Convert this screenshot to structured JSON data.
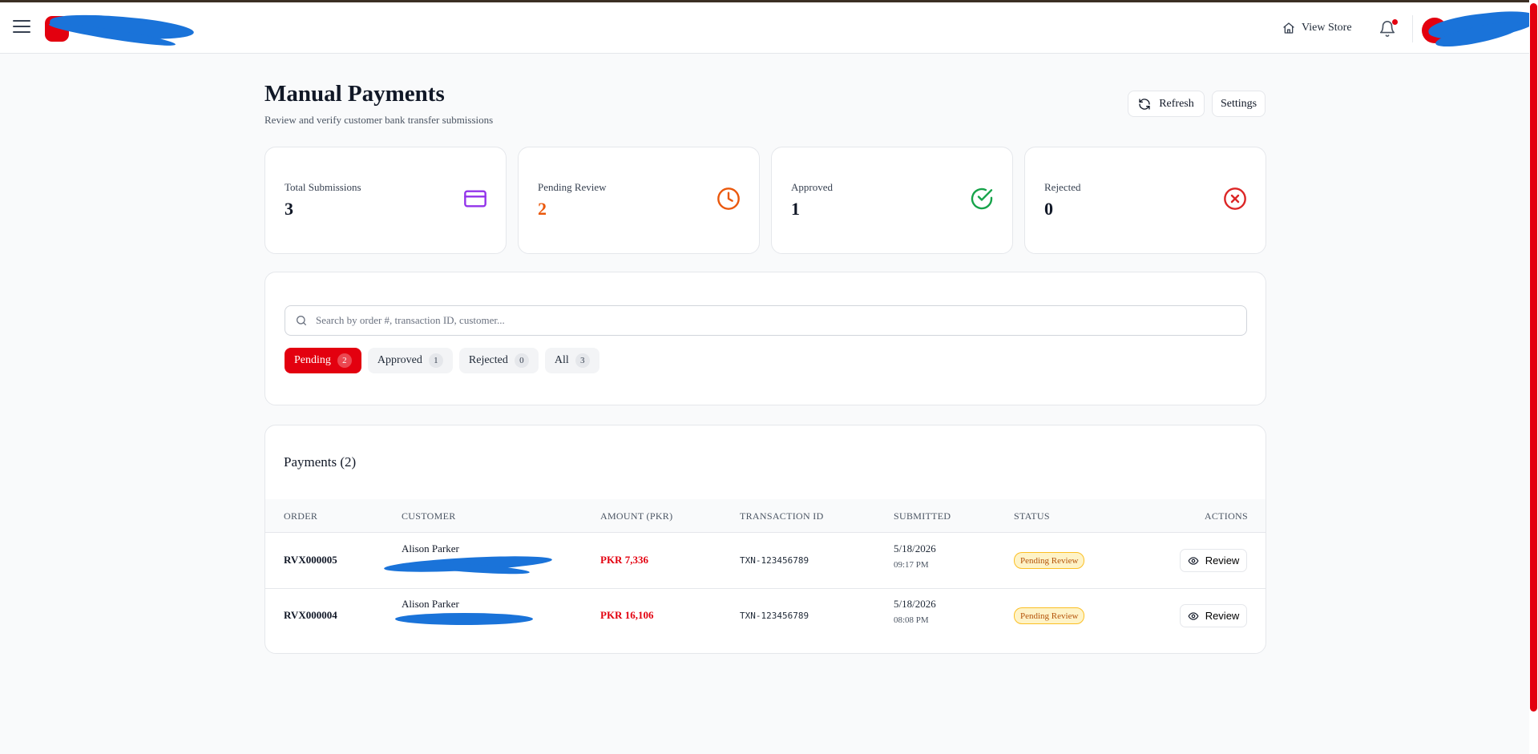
{
  "header": {
    "view_store": "View Store"
  },
  "page": {
    "title": "Manual Payments",
    "subtitle": "Review and verify customer bank transfer submissions",
    "refresh_label": "Refresh",
    "settings_label": "Settings"
  },
  "stats": [
    {
      "label": "Total Submissions",
      "value": "3",
      "color": "#111827",
      "icon": "credit-card-icon",
      "icon_color": "#9333ea"
    },
    {
      "label": "Pending Review",
      "value": "2",
      "color": "#ea580c",
      "icon": "clock-icon",
      "icon_color": "#ea580c"
    },
    {
      "label": "Approved",
      "value": "1",
      "color": "#111827",
      "icon": "check-circle-icon",
      "icon_color": "#16a34a"
    },
    {
      "label": "Rejected",
      "value": "0",
      "color": "#111827",
      "icon": "x-circle-icon",
      "icon_color": "#dc2626"
    }
  ],
  "filters": {
    "search_placeholder": "Search by order #, transaction ID, customer...",
    "tabs": [
      {
        "label": "Pending",
        "count": "2",
        "active": true
      },
      {
        "label": "Approved",
        "count": "1",
        "active": false
      },
      {
        "label": "Rejected",
        "count": "0",
        "active": false
      },
      {
        "label": "All",
        "count": "3",
        "active": false
      }
    ]
  },
  "payments": {
    "title": "Payments (2)",
    "columns": [
      "ORDER",
      "CUSTOMER",
      "AMOUNT (PKR)",
      "TRANSACTION ID",
      "SUBMITTED",
      "STATUS",
      "ACTIONS"
    ],
    "rows": [
      {
        "order": "RVX000005",
        "customer": "Alison Parker",
        "amount": "PKR 7,336",
        "txn": "TXN-123456789",
        "date": "5/18/2026",
        "time": "09:17 PM",
        "status": "Pending Review",
        "action": "Review"
      },
      {
        "order": "RVX000004",
        "customer": "Alison Parker",
        "amount": "PKR 16,106",
        "txn": "TXN-123456789",
        "date": "5/18/2026",
        "time": "08:08 PM",
        "status": "Pending Review",
        "action": "Review"
      }
    ]
  },
  "colors": {
    "accent": "#e3000f",
    "pending_badge_bg": "#fef3c7",
    "pending_badge_text": "#b45309"
  }
}
